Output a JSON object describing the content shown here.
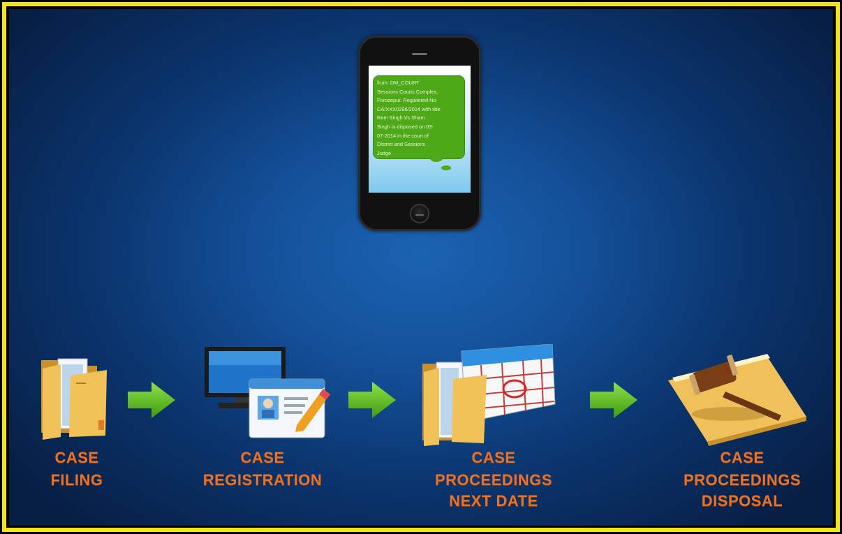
{
  "phone": {
    "sms_text": "from: DM_COURT\nSessions Courts Complex,\nFerozepur. Registered No\nCA/XXX0296/2014 with title\nRam Singh Vs Sham\nSingh is disposed on 03-\n07-2014 in the court of\nDistrict and Sessions\nJudge"
  },
  "steps": [
    {
      "line1": "CASE",
      "line2": "FILING",
      "icon": "folder-icon"
    },
    {
      "line1": "CASE",
      "line2": "REGISTRATION",
      "icon": "computer-registration-icon"
    },
    {
      "line1": "CASE",
      "line2": "PROCEEDINGS",
      "line3": "NEXT DATE",
      "icon": "calendar-folder-icon"
    },
    {
      "line1": "CASE",
      "line2": "PROCEEDINGS",
      "line3": "DISPOSAL",
      "icon": "gavel-icon"
    }
  ],
  "colors": {
    "frame": "#f4e21a",
    "background": "#145099",
    "label_orange": "#e8722a",
    "arrow_green": "#5bb81d",
    "sms_bubble": "#4ea918"
  }
}
